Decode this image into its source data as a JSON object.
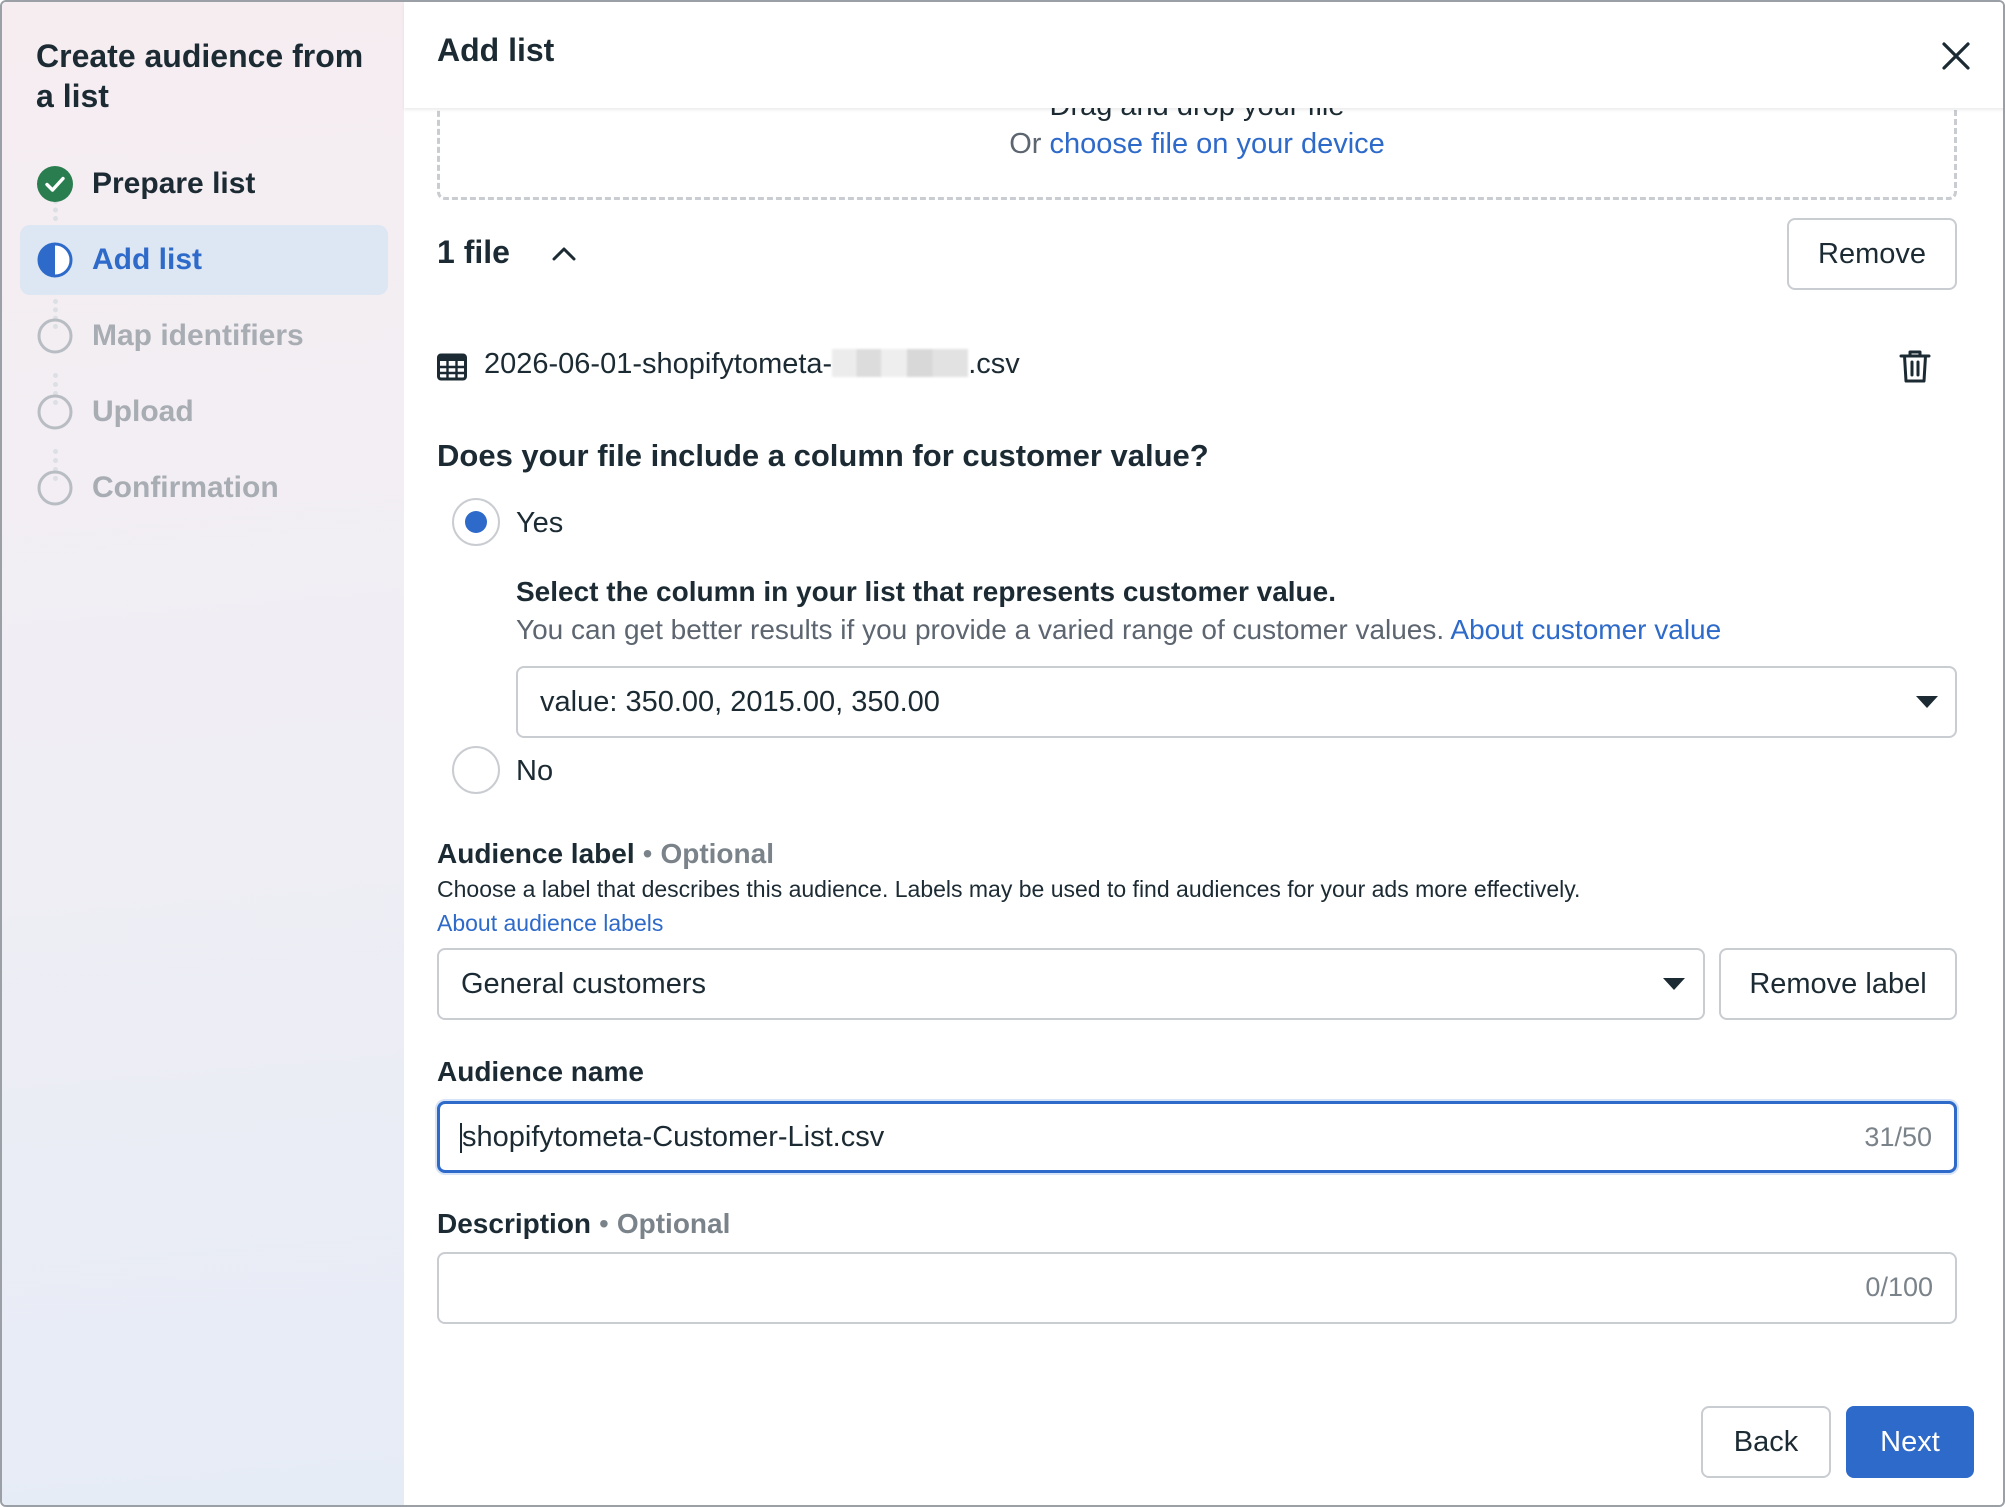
{
  "sidebar": {
    "title": "Create audience from a list",
    "steps": [
      {
        "label": "Prepare list",
        "state": "complete"
      },
      {
        "label": "Add list",
        "state": "active"
      },
      {
        "label": "Map identifiers",
        "state": "pending"
      },
      {
        "label": "Upload",
        "state": "pending"
      },
      {
        "label": "Confirmation",
        "state": "pending"
      }
    ]
  },
  "header": {
    "title": "Add list",
    "close_icon": "close-icon"
  },
  "dropzone": {
    "drag_text": "Drag and drop your file",
    "or_text": "Or",
    "choose_link": "choose file on your device"
  },
  "files": {
    "count_label": "1 file",
    "remove_label": "Remove",
    "file_name_prefix": "2026-06-01-shopifytometa-",
    "file_name_suffix": ".csv"
  },
  "customer_value": {
    "question": "Does your file include a column for customer value?",
    "yes_label": "Yes",
    "no_label": "No",
    "selected": "Yes",
    "column_heading": "Select the column in your list that represents customer value.",
    "column_help": "You can get better results if you provide a varied range of customer values.",
    "about_link": "About customer value",
    "column_select_value": "value: 350.00, 2015.00, 350.00"
  },
  "audience_label": {
    "label": "Audience label",
    "optional": "Optional",
    "help": "Choose a label that describes this audience. Labels may be used to find audiences for your ads more effectively.",
    "about_link": "About audience labels",
    "select_value": "General customers",
    "remove_label_button": "Remove label"
  },
  "audience_name": {
    "label": "Audience name",
    "value": "shopifytometa-Customer-List.csv",
    "counter": "31/50"
  },
  "description": {
    "label": "Description",
    "optional": "Optional",
    "value": "",
    "counter": "0/100"
  },
  "footer": {
    "back_label": "Back",
    "next_label": "Next"
  },
  "colors": {
    "accent": "#2e6ac9",
    "success": "#2a7d4f",
    "text": "#1c2b33",
    "muted": "#a7adb3"
  }
}
